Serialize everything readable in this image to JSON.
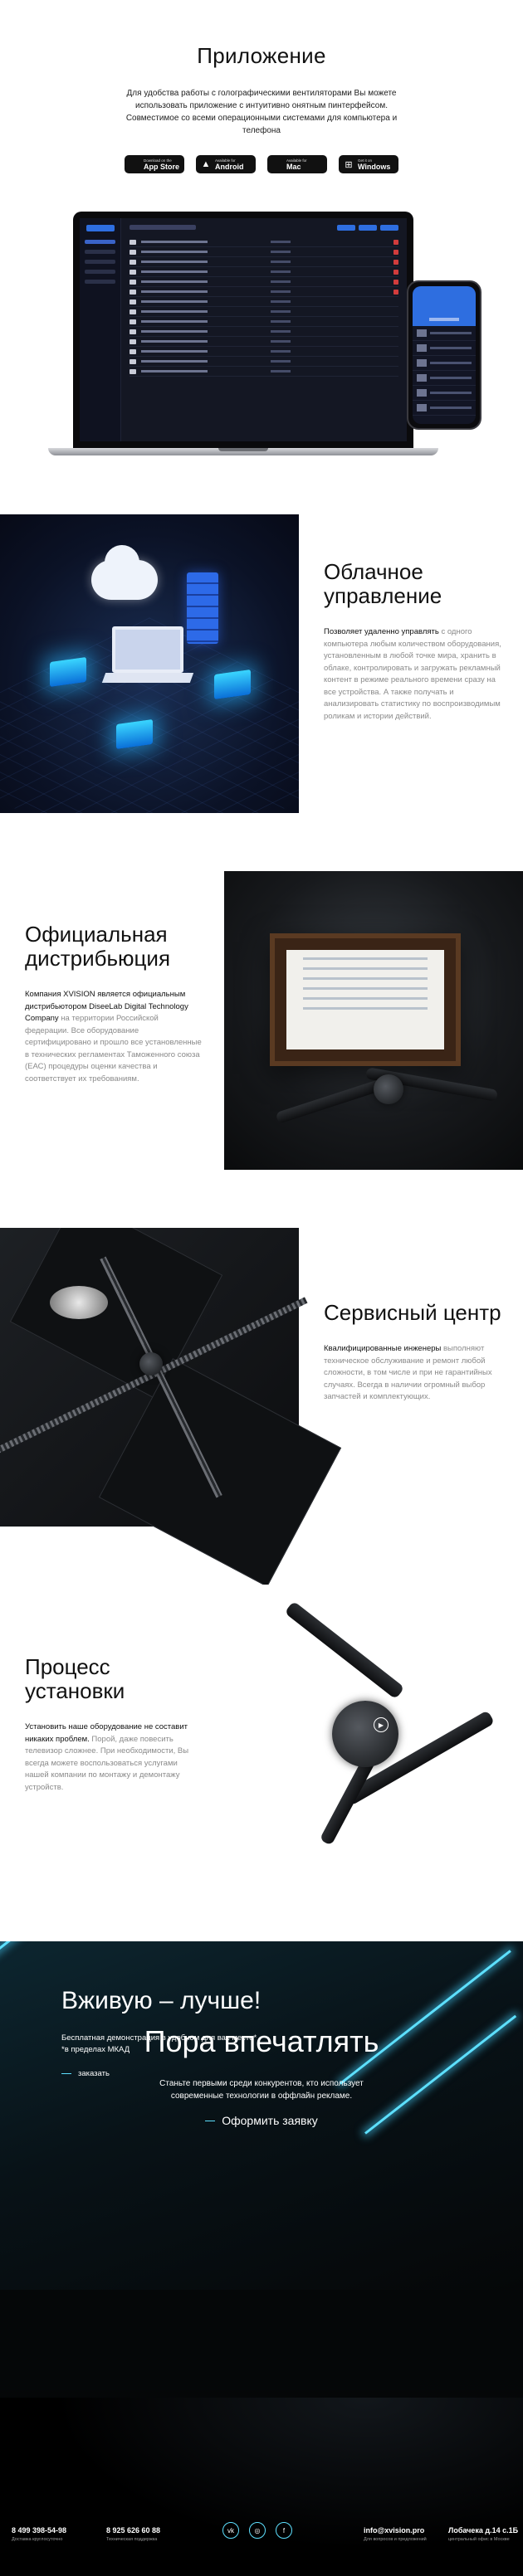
{
  "app": {
    "title": "Приложение",
    "description": "Для удобства работы с голографическими вентиляторами Вы можете использовать приложение с интуитивно онятным пинтерфейсом. Совместимое со всеми операционными системами для компьютера и телефона",
    "badges": [
      {
        "small": "Download on the",
        "big": "App Store",
        "icon": "apple-icon",
        "glyph": ""
      },
      {
        "small": "Available for",
        "big": "Android",
        "icon": "android-icon",
        "glyph": "▲"
      },
      {
        "small": "Available for",
        "big": "Mac",
        "icon": "mac-icon",
        "glyph": ""
      },
      {
        "small": "Get it on",
        "big": "Windows",
        "icon": "windows-icon",
        "glyph": "⊞"
      }
    ]
  },
  "cloud": {
    "title": "Облачное управление",
    "lead": "Позволяет удаленно управлять",
    "body": " с одного компьютера любым количеством оборудования, установленным в любой точке мира, хранить в облаке, контролировать и загружать рекламный контент в режиме реального времени сразу на все устройства. А также получать и анализировать статистику по воспроизводимым роликам и истории действий."
  },
  "distribution": {
    "title": "Официальная дистрибьюция",
    "lead": "Компания XVISION является официальным дистрибьютором DiseeLab Digital Technology Company",
    "body": " на территории Российской федерации. Все оборудование сертифицировано и прошло все установленные в технических регламентах Таможенного союза (ЕАС) процедуры оценки качества и соответствует их требованиям."
  },
  "service": {
    "title": "Сервисный центр",
    "lead": "Квалифицированные инженеры",
    "body": " выполняют техническое обслуживание и ремонт любой сложности, в том числе и при не гарантийных случаях. Всегда в наличии огромный выбор запчастей и комплектующих."
  },
  "install": {
    "title": "Процесс установки",
    "lead": "Установить наше оборудование не составит никаких проблем.",
    "body": " Порой, даже повесить телевизор сложнее. При необходимости, Вы всегда можете воспользоваться услугами нашей компании по монтажу и демонтажу устройств."
  },
  "live": {
    "title": "Вживую – лучше!",
    "line1": "Бесплатная демонстрация в удобном для вас месте*",
    "line2": "*в пределах МКАД",
    "link": "заказать"
  },
  "impress": {
    "title": "Пора впечатлять",
    "subtitle": "Станьте первыми среди конкурентов, кто использует современные технологии в оффлайн рекламе.",
    "link": "Оформить заявку"
  },
  "footer": {
    "phone1": {
      "value": "8 499 398-54-98",
      "label": "Доставка круглосуточно"
    },
    "phone2": {
      "value": "8 925 626 60 88",
      "label": "Техническая поддержка"
    },
    "email": {
      "value": "info@xvision.pro",
      "label": "Для вопросов и предложений"
    },
    "address": {
      "value": "Лобачека д.14 с.1Б",
      "label": "центральный офис в Москве"
    },
    "socials": [
      {
        "icon": "vk-icon",
        "glyph": "vk"
      },
      {
        "icon": "instagram-icon",
        "glyph": "◎"
      },
      {
        "icon": "facebook-icon",
        "glyph": "f"
      }
    ]
  }
}
